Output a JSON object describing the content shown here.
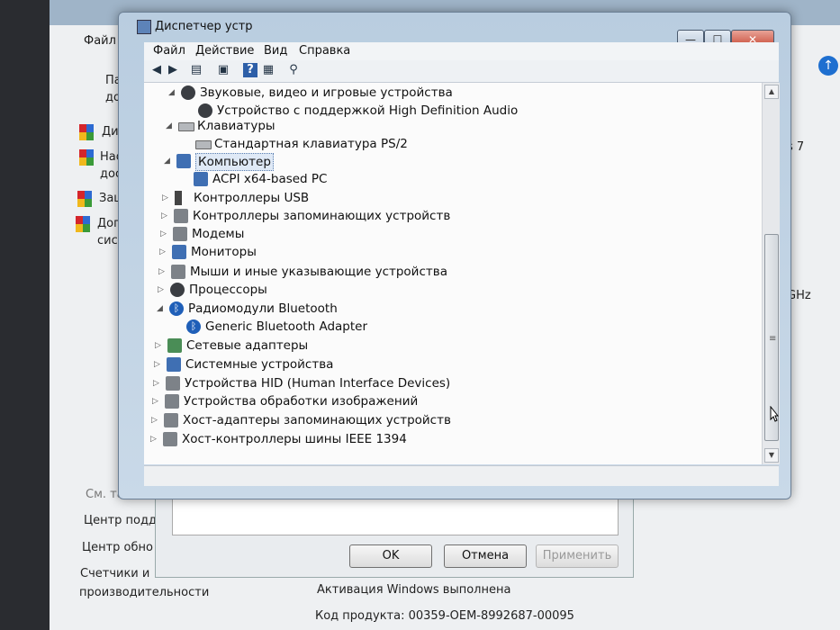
{
  "background": {
    "menu_file": "Файл",
    "side_items": [
      "Пане",
      "дома",
      "Дисп",
      "Наст",
      "досту",
      "Защи",
      "Допо",
      "систе"
    ],
    "right_fragments": [
      "s 7",
      "GHz"
    ],
    "see_also": "См. также",
    "links": [
      "Центр подде",
      "Центр обно",
      "Счетчики и",
      "производительности"
    ],
    "activation": "Активация Windows выполнена",
    "product_key": "Код продукта: 00359-OEM-8992687-00095"
  },
  "dialog": {
    "ok": "OK",
    "cancel": "Отмена",
    "apply": "Применить"
  },
  "window": {
    "title": "Диспетчер устр",
    "minimize": "—",
    "maximize": "☐",
    "close": "✕"
  },
  "menu": [
    "Файл",
    "Действие",
    "Вид",
    "Справка"
  ],
  "toolbar": [
    "back-arrow-icon",
    "forward-arrow-icon",
    "properties-icon",
    "show-hide-icon",
    "help-icon",
    "view-icon",
    "scan-hardware-icon"
  ],
  "tree": [
    {
      "label": "Звуковые, видео и игровые устройства",
      "level": 0,
      "expanded": true,
      "icon": "speaker-icon"
    },
    {
      "label": "Устройство с поддержкой High Definition Audio",
      "level": 1,
      "icon": "speaker-icon"
    },
    {
      "label": "Клавиатуры",
      "level": 0,
      "expanded": true,
      "icon": "keyboard-icon"
    },
    {
      "label": "Стандартная клавиатура PS/2",
      "level": 1,
      "icon": "keyboard-icon"
    },
    {
      "label": "Компьютер",
      "level": 0,
      "expanded": true,
      "icon": "computer-icon",
      "selected": true
    },
    {
      "label": "ACPI x64-based PC",
      "level": 1,
      "icon": "computer-icon"
    },
    {
      "label": "Контроллеры USB",
      "level": 0,
      "expanded": false,
      "icon": "usb-icon"
    },
    {
      "label": "Контроллеры запоминающих устройств",
      "level": 0,
      "expanded": false,
      "icon": "storage-controller-icon"
    },
    {
      "label": "Модемы",
      "level": 0,
      "expanded": false,
      "icon": "modem-icon"
    },
    {
      "label": "Мониторы",
      "level": 0,
      "expanded": false,
      "icon": "monitor-icon"
    },
    {
      "label": "Мыши и иные указывающие устройства",
      "level": 0,
      "expanded": false,
      "icon": "mouse-icon"
    },
    {
      "label": "Процессоры",
      "level": 0,
      "expanded": false,
      "icon": "processor-icon"
    },
    {
      "label": "Радиомодули Bluetooth",
      "level": 0,
      "expanded": true,
      "icon": "bluetooth-icon"
    },
    {
      "label": "Generic Bluetooth Adapter",
      "level": 1,
      "icon": "bluetooth-icon"
    },
    {
      "label": "Сетевые адаптеры",
      "level": 0,
      "expanded": false,
      "icon": "network-icon"
    },
    {
      "label": "Системные устройства",
      "level": 0,
      "expanded": false,
      "icon": "system-icon"
    },
    {
      "label": "Устройства HID (Human Interface Devices)",
      "level": 0,
      "expanded": false,
      "icon": "hid-icon"
    },
    {
      "label": "Устройства обработки изображений",
      "level": 0,
      "expanded": false,
      "icon": "camera-icon"
    },
    {
      "label": "Хост-адаптеры запоминающих устройств",
      "level": 0,
      "expanded": false,
      "icon": "storage-host-icon"
    },
    {
      "label": "Хост-контроллеры шины IEEE 1394",
      "level": 0,
      "expanded": false,
      "icon": "ieee1394-icon"
    }
  ]
}
